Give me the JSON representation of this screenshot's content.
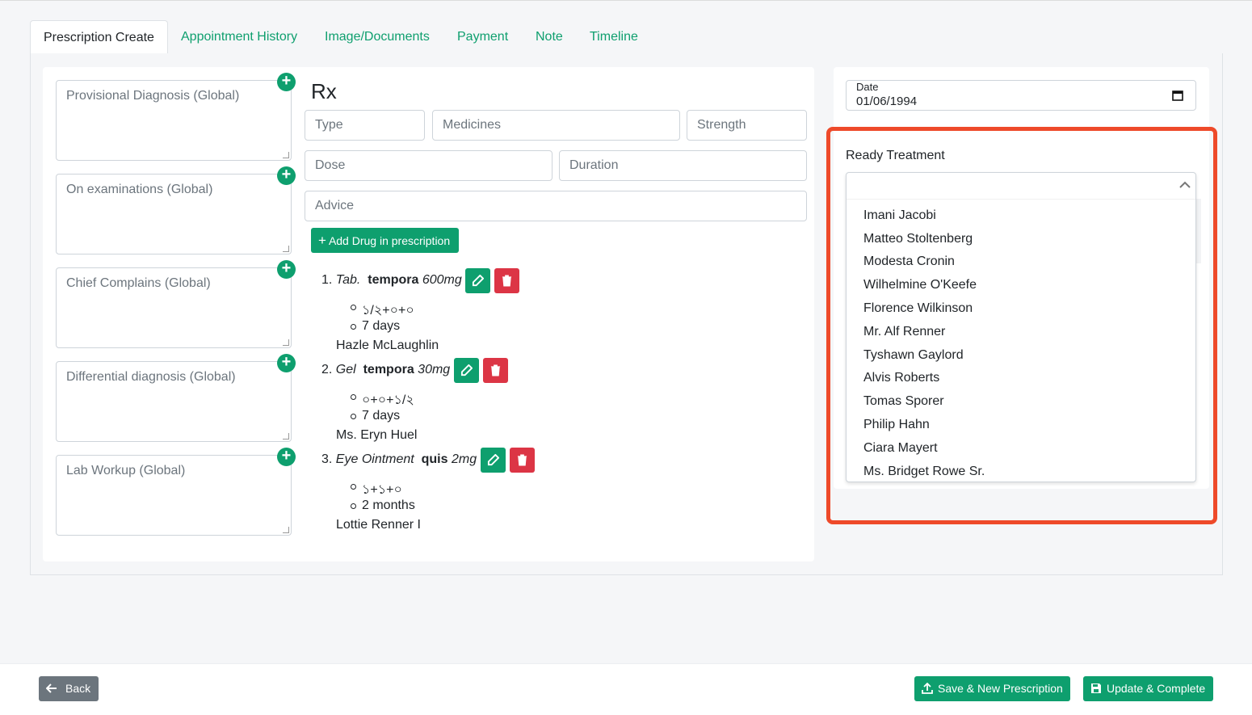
{
  "tabs": [
    "Prescription Create",
    "Appointment History",
    "Image/Documents",
    "Payment",
    "Note",
    "Timeline"
  ],
  "global_fields": [
    "Provisional Diagnosis (Global)",
    "On examinations (Global)",
    "Chief Complains (Global)",
    "Differential diagnosis (Global)",
    "Lab Workup (Global)"
  ],
  "rx": {
    "title": "Rx",
    "placeholders": {
      "type": "Type",
      "medicines": "Medicines",
      "strength": "Strength",
      "dose": "Dose",
      "duration": "Duration",
      "advice": "Advice"
    },
    "add_button": "Add Drug in prescription",
    "drugs": [
      {
        "num": "1.",
        "type": "Tab.",
        "name": "tempora",
        "strength": "600mg",
        "dose": "১/২+০+০",
        "duration": "7 days",
        "by": "Hazle McLaughlin"
      },
      {
        "num": "2.",
        "type": "Gel",
        "name": "tempora",
        "strength": "30mg",
        "dose": "০+০+১/২",
        "duration": "7 days",
        "by": "Ms. Eryn Huel"
      },
      {
        "num": "3.",
        "type": "Eye Ointment",
        "name": "quis",
        "strength": "2mg",
        "dose": "১+১+০",
        "duration": "2 months",
        "by": "Lottie Renner I"
      }
    ]
  },
  "date": {
    "label": "Date",
    "value": "01/06/1994"
  },
  "ready_treatment": {
    "label": "Ready Treatment",
    "options": [
      "Imani Jacobi",
      "Matteo Stoltenberg",
      "Modesta Cronin",
      "Wilhelmine O'Keefe",
      "Florence Wilkinson",
      "Mr. Alf Renner",
      "Tyshawn Gaylord",
      "Alvis Roberts",
      "Tomas Sporer",
      "Philip Hahn",
      "Ciara Mayert",
      "Ms. Bridget Rowe Sr."
    ]
  },
  "footer": {
    "back": "Back",
    "save_new": "Save & New Prescription",
    "update": "Update & Complete"
  },
  "colors": {
    "primary": "#0e9f6e",
    "danger": "#dc3545",
    "secondary": "#6c757d",
    "highlight": "#ee4a2a"
  }
}
